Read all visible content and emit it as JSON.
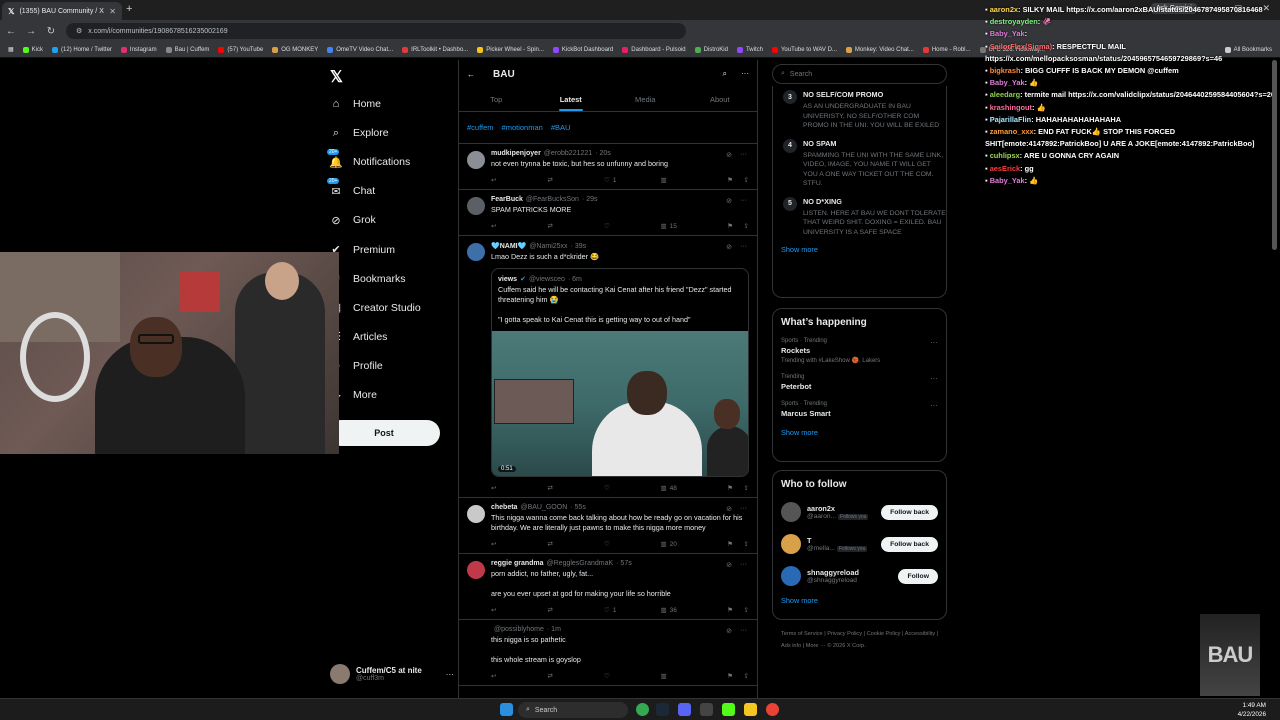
{
  "browser": {
    "tab_title": "(1355) BAU Community / X",
    "url": "x.com/i/communities/1908678516235002169",
    "ask_gemini": "Ask Gemini",
    "bookmarks": [
      "Kick",
      "(12) Home / Twitter",
      "Instagram",
      "Bau | Cuffem",
      "(57) YouTube",
      "OG MONKEY",
      "OmeTV Video Chat...",
      "IRLToolkit • Dashbo...",
      "Picker Wheel - Spin...",
      "KickBot Dashboard",
      "Dashboard - Pulsoid",
      "DistroKid",
      "Twitch",
      "YouTube to WAV D...",
      "Monkey: Video Chat...",
      "Home - Robl...",
      "UFC 326: Holloway...",
      "All Bookmarks"
    ]
  },
  "leftnav": {
    "items": [
      {
        "label": "Home",
        "icon": "home-icon"
      },
      {
        "label": "Explore",
        "icon": "search-icon"
      },
      {
        "label": "Notifications",
        "icon": "bell-icon",
        "badge": "20+"
      },
      {
        "label": "Chat",
        "icon": "chat-icon",
        "badge": "20+"
      },
      {
        "label": "Grok",
        "icon": "grok-icon"
      },
      {
        "label": "Premium",
        "icon": "premium-icon"
      },
      {
        "label": "Bookmarks",
        "icon": "bookmark-icon"
      },
      {
        "label": "Creator Studio",
        "icon": "creator-icon"
      },
      {
        "label": "Articles",
        "icon": "articles-icon"
      },
      {
        "label": "Profile",
        "icon": "profile-icon"
      },
      {
        "label": "More",
        "icon": "more-icon"
      }
    ],
    "post_label": "Post",
    "account": {
      "name": "Cuffem/C5 at nite",
      "handle": "@cuff3m"
    }
  },
  "feed": {
    "title": "BAU",
    "tabs": [
      "Top",
      "Latest",
      "Media",
      "About"
    ],
    "active_tab": "Latest",
    "hashtags": [
      "#cuffem",
      "#motionman",
      "#BAU"
    ],
    "tweets": [
      {
        "name": "mudkipenjoyer",
        "handle": "@erobb221221",
        "time": "· 20s",
        "text": "not even trynna be toxic, but hes so unfunny and boring",
        "likes": "1",
        "views": "",
        "avatar_color": "#8a8f96"
      },
      {
        "name": "FearBuck",
        "handle": "@FearBucksSon",
        "time": "· 29s",
        "text": "SPAM PATRICKS MORE",
        "likes": "",
        "views": "15",
        "avatar_color": "#5b5f66"
      },
      {
        "name": "🩵NAMI🩵",
        "handle": "@Nami25xx",
        "time": "· 39s",
        "text": "Lmao Dezz is such a d*ckrider 😂",
        "likes": "",
        "views": "48",
        "avatar_color": "#3d6fa8",
        "quote": {
          "name": "views",
          "handle": "@viewsceo",
          "time": "· 6m",
          "text": "Cuffem said he will be contacting Kai Cenat after his friend \"Dezz\" started threatening him 😭\n\n\"I gotta speak to Kai Cenat this is getting way to out of hand\"",
          "duration": "0:51"
        }
      },
      {
        "name": "chebeta",
        "handle": "@BAU_GOON",
        "time": "· 55s",
        "text": "This nigga wanna come back talking about how be ready go on vacation for his birthday. We are literally just pawns to make this nigga more money",
        "likes": "",
        "views": "20",
        "avatar_color": "#c9c9c9"
      },
      {
        "name": "reggie grandma",
        "handle": "@RegglesGrandmaK",
        "time": "· 57s",
        "text": "porn addict, no father, ugly, fat...\n\nare you ever upset at god for making your life so horrible",
        "likes": "1",
        "views": "36",
        "avatar_color": "#c0394b"
      },
      {
        "name": "",
        "handle": "@possiblyhome",
        "time": "· 1m",
        "text": "this nigga is so pathetic\n\nthis whole stream is goyslop",
        "likes": "",
        "views": "",
        "avatar_color": "#000"
      }
    ]
  },
  "rightcol": {
    "search_placeholder": "Search",
    "rules": [
      {
        "num": "3",
        "title": "NO SELF/COM PROMO",
        "desc": "AS AN UNDERGRADUATE IN BAU UNIVERISTY, NO SELF/OTHER COM PROMO IN THE UNI. YOU WILL BE EXILED"
      },
      {
        "num": "4",
        "title": "NO SPAM",
        "desc": "SPAMMING THE UNI WITH THE SAME LINK, VIDEO, IMAGE, YOU NAME IT WILL GET YOU A ONE WAY TICKET OUT THE COM. STFU."
      },
      {
        "num": "5",
        "title": "NO D*XING",
        "desc": "LISTEN. HERE AT BAU WE DONT TOLERATE THAT WEIRD SHIT. DOXING = EXILED. BAU UNIVERSITY IS A SAFE SPACE"
      }
    ],
    "show_more": "Show more",
    "happening_title": "What’s happening",
    "trends": [
      {
        "context": "Sports · Trending",
        "title": "Rockets",
        "extra": "Trending with #LakeShow 🏀, Lakers"
      },
      {
        "context": "Trending",
        "title": "Peterbot",
        "extra": ""
      },
      {
        "context": "Sports · Trending",
        "title": "Marcus Smart",
        "extra": ""
      }
    ],
    "wtf_title": "Who to follow",
    "follows": [
      {
        "name": "aaron2x",
        "handle": "@aaron...",
        "follows_you": "Follows you",
        "button": "Follow back",
        "avatar_color": "#555"
      },
      {
        "name": "T",
        "handle": "@mella...",
        "follows_you": "Follows you",
        "button": "Follow back",
        "avatar_color": "#d9a04a"
      },
      {
        "name": "shnaggyreload",
        "handle": "@shnaggyreload",
        "follows_you": "",
        "button": "Follow",
        "avatar_color": "#2a6ab5"
      }
    ],
    "footer": "Terms of Service | Privacy Policy | Cookie Policy | Accessibility | Ads info | More ··· © 2026 X Corp."
  },
  "chat": [
    {
      "user": "aaron2x",
      "msg": "SILKY MAIL https://x.com/aaron2xBAU/status/2046787495870816468",
      "color": "#ffd84a"
    },
    {
      "user": "destroyayden",
      "msg": "🦑",
      "color": "#7cf27c"
    },
    {
      "user": "Baby_Yak",
      "msg": "",
      "color": "#e07cd9"
    },
    {
      "user": "SailorFlex(Sigma)",
      "msg": "RESPECTFUL MAIL https://x.com/mellopacksosman/status/2045965754659729869?s=46",
      "color": "#ff6b6b"
    },
    {
      "user": "bigkrash",
      "msg": "BIGG CUFFF IS BACK MY DEMON @cuffem",
      "color": "#ff8c3a"
    },
    {
      "user": "Baby_Yak",
      "msg": "👍",
      "color": "#e07cd9"
    },
    {
      "user": "aleedarg",
      "msg": "termite mail https://x.com/validclipx/status/2046440259584405604?s=20",
      "color": "#8fd14f"
    },
    {
      "user": "krashingout",
      "msg": "👍",
      "color": "#ff6b9e"
    },
    {
      "user": "PajarillaFlin",
      "msg": "HAHAHAHAHAHAHAHA",
      "color": "#a8e6ff"
    },
    {
      "user": "zamano_xxx",
      "msg": "END FAT FUCK👍 STOP THIS FORCED SHIT[emote:4147892:PatrickBoo] U ARE A JOKE[emote:4147892:PatrickBoo]",
      "color": "#ff9a3c"
    },
    {
      "user": "cuhlipsx",
      "msg": "ARE U GONNA CRY AGAIN",
      "color": "#9ad85a"
    },
    {
      "user": "aesErick",
      "msg": "gg",
      "color": "#ff3a3a"
    },
    {
      "user": "Baby_Yak",
      "msg": "👍",
      "color": "#e07cd9"
    }
  ],
  "taskbar": {
    "search": "Search",
    "time": "1:49 AM",
    "date": "4/22/2026"
  },
  "overlay_logo": "BAU"
}
